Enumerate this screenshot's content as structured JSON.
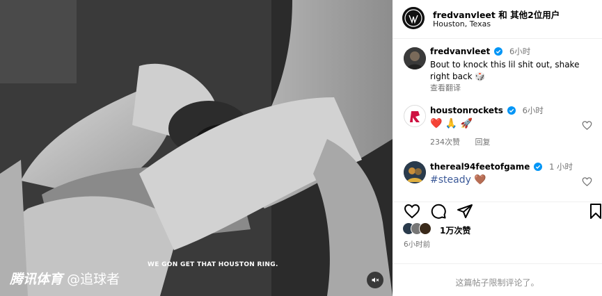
{
  "media": {
    "caption": "WE GON GET THAT HOUSTON RING.",
    "watermark_brand": "腾讯体育",
    "watermark_handle": "@追球者",
    "mute_icon": "speaker-muted-icon"
  },
  "header": {
    "username": "fredvanvleet 和 其他2位用户",
    "location": "Houston, Texas"
  },
  "comments": [
    {
      "username": "fredvanvleet",
      "time": "6小时",
      "text_line1": "Bout to knock this lil shit out, shake",
      "text_line2": "right back 🎲",
      "translate": "查看翻译"
    },
    {
      "username": "houstonrockets",
      "time": "6小时",
      "text": "❤️ 🙏 🚀",
      "likes": "234次赞",
      "reply": "回复"
    },
    {
      "username": "thereal94feetofgame",
      "time": "1 小时",
      "hashtag": "#steady",
      "emoji": "🤎"
    }
  ],
  "stats": {
    "likes": "1万次赞",
    "posted": "6小时前"
  },
  "footer": {
    "limited_text": "这篇帖子限制评论了。"
  },
  "colors": {
    "verified": "#0095f6",
    "muted_text": "#737373",
    "rockets_red": "#ce1141"
  }
}
